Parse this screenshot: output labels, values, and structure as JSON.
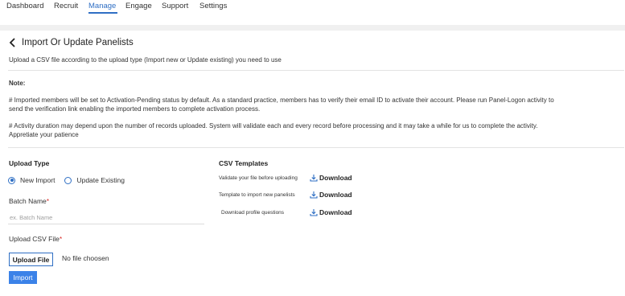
{
  "nav": {
    "items": [
      "Dashboard",
      "Recruit",
      "Manage",
      "Engage",
      "Support",
      "Settings"
    ],
    "active": "Manage"
  },
  "page": {
    "title": "Import Or Update Panelists",
    "subtitle": "Upload a CSV file according to the upload type (Import new or Update existing) you need to use"
  },
  "note": {
    "label": "Note:",
    "para1_line1": "# Imported members will be set to Activation-Pending status by default. As a standard practice, members has to verify their email ID to activate their account. Please run Panel-Logon activity to",
    "para1_line2": "send the verification link enabling the imported members to complete activation process.",
    "para2_line1": "# Activity duration may depend upon the number of records uploaded. System will validate each and every record before processing and it may take a while for us to complete the activity.",
    "para2_line2": "Appretiate your patience"
  },
  "upload_type": {
    "title": "Upload Type",
    "options": [
      "New Import",
      "Update Existing"
    ],
    "selected": "New Import"
  },
  "batch": {
    "label": "Batch Name",
    "required_mark": "*",
    "placeholder": "ex. Batch Name",
    "value": ""
  },
  "csv_file": {
    "label": "Upload CSV File",
    "required_mark": "*",
    "button_label": "Upload File",
    "status": "No file choosen"
  },
  "import_button": "Import",
  "templates": {
    "title": "CSV Templates",
    "rows": [
      {
        "label": "Validate your file before uploading",
        "link": "Download"
      },
      {
        "label": "Template to import new panelists",
        "link": "Download"
      },
      {
        "label": "Download profile questions",
        "link": "Download"
      }
    ]
  },
  "colors": {
    "accent": "#2f6fc4",
    "import_button": "#3b82e8",
    "required": "#d9302c"
  },
  "icons": {
    "back": "chevron-left-icon",
    "download": "download-icon"
  }
}
